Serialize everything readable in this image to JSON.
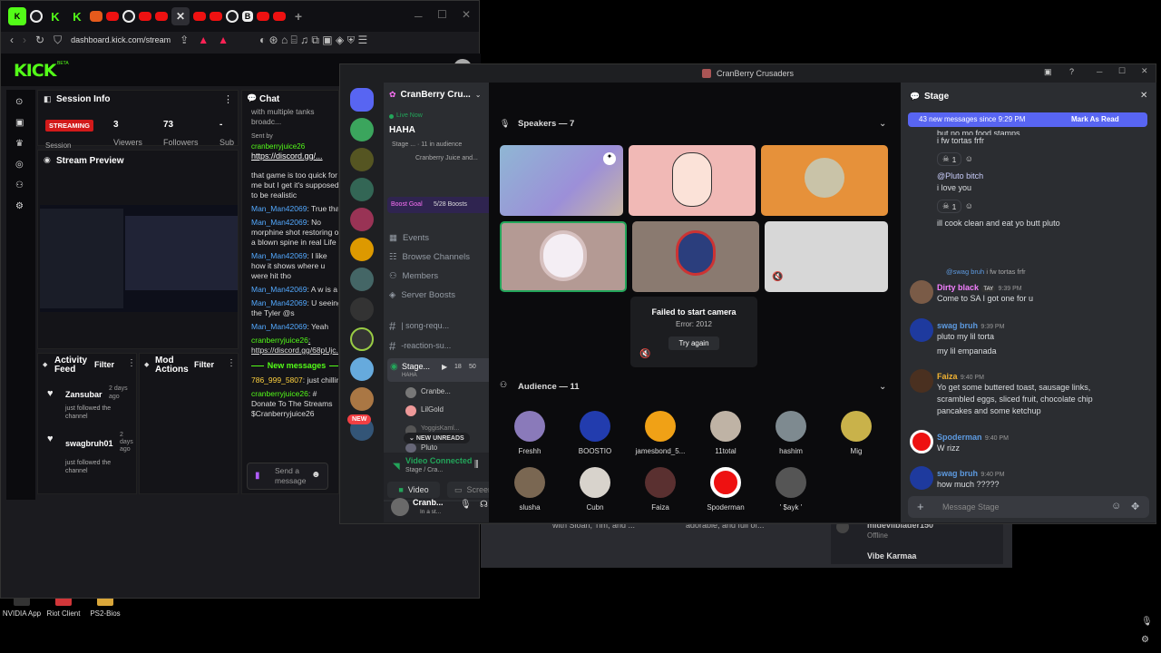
{
  "desktop": {
    "icons": [
      {
        "label": "NVIDIA App"
      },
      {
        "label": "Riot Client"
      },
      {
        "label": "PS2-Bios"
      }
    ]
  },
  "browser": {
    "url": "dashboard.kick.com/stream",
    "kick_logo": "KICK",
    "beta": "BETA",
    "session_info": {
      "title": "Session Info",
      "status": "STREAMING",
      "session_label": "Session",
      "viewers": "3",
      "viewers_label": "Viewers",
      "followers": "73",
      "followers_label": "Followers",
      "subs": "-",
      "subs_label": "Sub"
    },
    "stream_preview": "Stream Preview",
    "activity": {
      "title": "Activity Feed",
      "filter": "Filter",
      "items": [
        {
          "user": "Zansubar",
          "time": "2 days ago",
          "text": "just followed the channel"
        },
        {
          "user": "swagbruh01",
          "time": "2 days ago",
          "text": "just followed the channel"
        }
      ]
    },
    "mod_actions": {
      "title": "Mod Actions",
      "filter": "Filter"
    },
    "chat": {
      "title": "Chat",
      "lines": [
        {
          "user": "",
          "text": "with multiple tanks broadc..."
        },
        {
          "user": "Sent by",
          "text": ""
        },
        {
          "user": "cranberryjuice26",
          "text": ""
        },
        {
          "user": "",
          "text": "https://discord.gg/..."
        },
        {
          "user": "",
          "text": "that game is too quick for me but I get it's supposed to be realistic"
        },
        {
          "user": "Man_Man42069",
          "text": ": True that"
        },
        {
          "user": "Man_Man42069",
          "text": ": No morphine shot restoring of a blown spine in real Life"
        },
        {
          "user": "Man_Man42069",
          "text": ": I like how it shows where u were hit tho"
        },
        {
          "user": "Man_Man42069",
          "text": ": A w is a"
        },
        {
          "user": "Man_Man42069",
          "text": ": U seeing the Tyler @s"
        },
        {
          "user": "Man_Man42069",
          "text": ": Yeah"
        },
        {
          "user": "cranberryjuice26",
          "text": ": https://discord.gg/68pUjc..."
        }
      ],
      "new_messages": "New messages",
      "lines2": [
        {
          "user": "786_999_5807",
          "text": ": just chillin"
        },
        {
          "user": "cranberryjuice26",
          "text": ": # Donate To The Streams $Cranberryjuice26"
        }
      ],
      "send_placeholder": "Send a message"
    }
  },
  "discord": {
    "window_title": "CranBerry Crusaders",
    "server_name": "CranBerry Cru...",
    "new_badge": "NEW",
    "live_now": "Live Now",
    "live_title": "HAHA",
    "live_sub": "Stage ... · 11 in audience",
    "live_sub2": "Cranberry Juice and...",
    "boost_goal": "Boost Goal",
    "boost_count": "5/28 Boosts",
    "menu": [
      {
        "label": "Events",
        "icon": "calendar-icon"
      },
      {
        "label": "Browse Channels",
        "icon": "list-icon"
      },
      {
        "label": "Members",
        "icon": "members-icon"
      },
      {
        "label": "Server Boosts",
        "icon": "boost-icon"
      }
    ],
    "channels": [
      {
        "label": "| song-requ..."
      },
      {
        "label": "-reaction-su..."
      }
    ],
    "stage_channel": {
      "label": "Stage...",
      "sub": "HAHA",
      "count": "18",
      "count2": "50"
    },
    "stage_members": [
      {
        "label": "Cranbe..."
      },
      {
        "label": "LilGold"
      },
      {
        "label": "YoggisKaml..."
      },
      {
        "label": "Pluto"
      }
    ],
    "new_unreads": "NEW UNREADS",
    "voice": {
      "title": "Video Connected",
      "sub": "Stage / Cra...",
      "video": "Video",
      "screen": "Screen"
    },
    "user": {
      "name": "Cranb...",
      "status": "In a st..."
    },
    "speakers_header": "Speakers — 7",
    "camera_error": {
      "title": "Failed to start camera",
      "code": "Error: 2012",
      "retry": "Try again"
    },
    "audience_header": "Audience — 11",
    "audience": [
      {
        "name": "Freshh"
      },
      {
        "name": "BOOSTIO"
      },
      {
        "name": "jamesbond_5..."
      },
      {
        "name": "11total"
      },
      {
        "name": "hashim"
      },
      {
        "name": "Mig"
      },
      {
        "name": "slusha"
      },
      {
        "name": "Cubn"
      },
      {
        "name": "Faiza"
      },
      {
        "name": "Spoderman"
      },
      {
        "name": "' $ayk '"
      }
    ],
    "chat_title": "Stage",
    "banner": {
      "text": "43 new messages since 9:29 PM",
      "mark": "Mark As Read"
    },
    "messages": [
      {
        "name": "",
        "time": "",
        "text": "but no mo food stamps"
      },
      {
        "name": "",
        "time": "",
        "text": "i fw tortas frfr"
      },
      {
        "name": "",
        "time": "",
        "text": "1"
      },
      {
        "name": "",
        "time": "",
        "text": "@Pluto bitch"
      },
      {
        "name": "",
        "time": "",
        "text": "i love you"
      },
      {
        "name": "",
        "time": "",
        "text": "1"
      },
      {
        "name": "",
        "time": "",
        "text": "ill cook clean and eat yo butt pluto"
      },
      {
        "name": "@swag bruh",
        "time": "",
        "text": "i fw tortas frfr"
      },
      {
        "name": "Dirty black",
        "time": "9:39 PM",
        "text": "Come to SA I got one for u"
      },
      {
        "name": "swag bruh",
        "time": "9:39 PM",
        "text": "pluto my lil torta"
      },
      {
        "name": "",
        "time": "",
        "text": "my lil empanada"
      },
      {
        "name": "Faiza",
        "time": "9:40 PM",
        "text": "Yo get some buttered toast, sausage links, scrambled eggs, sliced fruit, chocolate chip pancakes and some ketchup"
      },
      {
        "name": "Spoderman",
        "time": "9:40 PM",
        "text": "W rizz"
      },
      {
        "name": "swag bruh",
        "time": "9:40 PM",
        "text": "how much ?????"
      }
    ],
    "tag": "TAY",
    "input_placeholder": "Message Stage"
  },
  "behind": {
    "text1": "with Sloan, Tim, and ...",
    "text2": "adorable, and full of...",
    "member1": "mideviibiader150",
    "member1_status": "Offline",
    "member2": "Vibe Karmaa"
  },
  "colors": {
    "kick_green": "#53fc18",
    "discord_blurple": "#5865f2",
    "discord_bg": "#2b2d31"
  }
}
